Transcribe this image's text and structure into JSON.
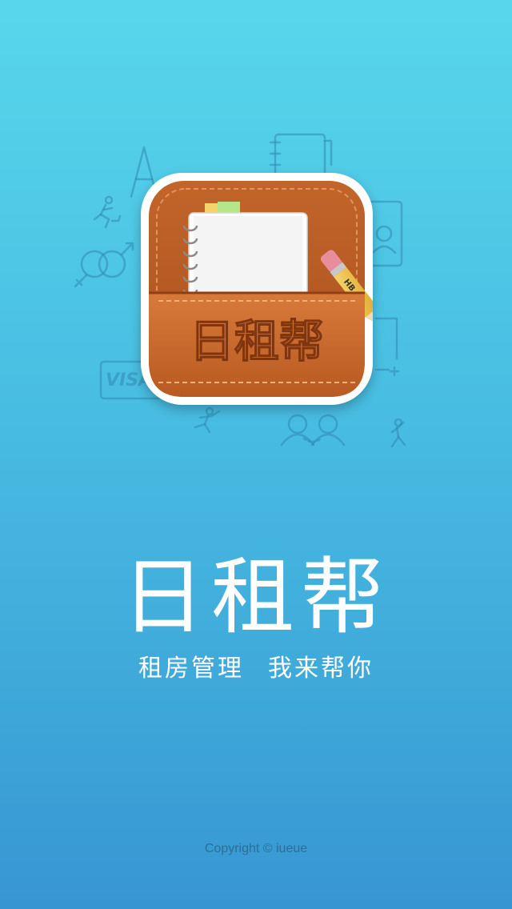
{
  "app": {
    "icon_label": "日租帮",
    "title": "日租帮",
    "tagline_left": "租房管理",
    "tagline_right": "我来帮你",
    "copyright": "Copyright © iueue",
    "pencil_label": "HB",
    "card_brand": "VISA"
  },
  "icons": [
    "font-icon",
    "notebook-icon",
    "runner-icon",
    "gender-icon",
    "id-card-icon",
    "credit-card-icon",
    "frame-icon",
    "stretch-figure-icon",
    "couple-icon",
    "dancer-icon",
    "pencil-icon"
  ],
  "colors": {
    "background_top": "#58d7ec",
    "background_bottom": "#3796d2",
    "icon_leather": "#c9682c",
    "icon_frame": "#ffffff",
    "text": "#ffffff"
  }
}
